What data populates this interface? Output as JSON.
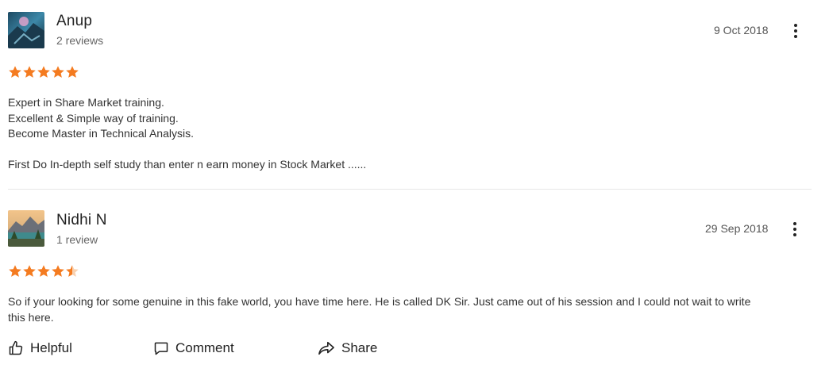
{
  "reviews": [
    {
      "author": "Anup",
      "review_count": "2 reviews",
      "date": "9 Oct 2018",
      "rating": 5,
      "lines": [
        "Expert in Share Market training.",
        "Excellent & Simple way of training.",
        "Become Master in Technical Analysis.",
        "",
        "First Do In-depth self study than enter n earn money in Stock Market ......"
      ]
    },
    {
      "author": "Nidhi N",
      "review_count": "1 review",
      "date": "29 Sep 2018",
      "rating": 4.5,
      "lines": [
        "So if your looking for some genuine in this fake world, you have time here. He is called DK Sir. Just came out of his session and I could not wait to write",
        "this here."
      ]
    }
  ],
  "actions": {
    "helpful_label": "Helpful",
    "comment_label": "Comment",
    "share_label": "Share"
  },
  "colors": {
    "star": "#f47b20",
    "star_empty": "#f9d1b0",
    "divider": "#e6e6e6"
  },
  "icons": {
    "more": "vertical-dots-icon",
    "helpful": "thumbs-up-icon",
    "comment": "comment-bubble-icon",
    "share": "share-arrow-icon"
  }
}
